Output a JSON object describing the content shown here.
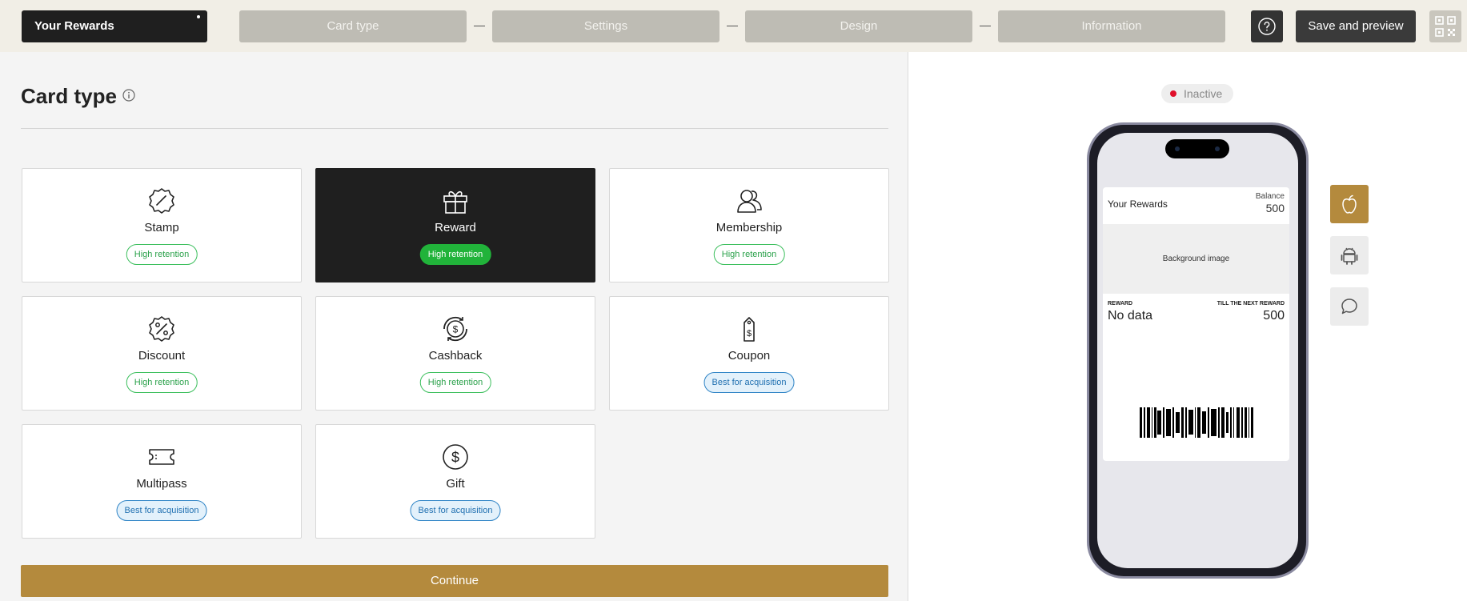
{
  "header": {
    "card_name": "Your Rewards",
    "steps": [
      "Card type",
      "Settings",
      "Design",
      "Information"
    ],
    "help_icon": "question-circle-icon",
    "save_label": "Save and preview",
    "qr_icon": "qr-code-icon"
  },
  "main": {
    "title": "Card type",
    "title_icon": "info-icon",
    "cards": [
      {
        "label": "Stamp",
        "badge": "High retention",
        "badge_style": "green",
        "icon": "stamp-icon",
        "selected": false
      },
      {
        "label": "Reward",
        "badge": "High retention",
        "badge_style": "green",
        "icon": "gift-box-icon",
        "selected": true
      },
      {
        "label": "Membership",
        "badge": "High retention",
        "badge_style": "green",
        "icon": "users-icon",
        "selected": false
      },
      {
        "label": "Discount",
        "badge": "High retention",
        "badge_style": "green",
        "icon": "percent-badge-icon",
        "selected": false
      },
      {
        "label": "Cashback",
        "badge": "High retention",
        "badge_style": "green",
        "icon": "cashback-icon",
        "selected": false
      },
      {
        "label": "Coupon",
        "badge": "Best for acquisition",
        "badge_style": "blue",
        "icon": "price-tag-icon",
        "selected": false
      },
      {
        "label": "Multipass",
        "badge": "Best for acquisition",
        "badge_style": "blue",
        "icon": "ticket-icon",
        "selected": false
      },
      {
        "label": "Gift",
        "badge": "Best for acquisition",
        "badge_style": "blue",
        "icon": "dollar-coin-icon",
        "selected": false
      }
    ],
    "continue_label": "Continue"
  },
  "preview": {
    "status": "Inactive",
    "status_color": "#e0102b",
    "pass": {
      "name": "Your Rewards",
      "balance_label": "Balance",
      "balance_value": "500",
      "background_text": "Background image",
      "field1_label": "REWARD",
      "field1_value": "No data",
      "field2_label": "TILL THE NEXT REWARD",
      "field2_value": "500"
    },
    "platform_buttons": [
      {
        "icon": "apple-icon",
        "active": true
      },
      {
        "icon": "android-icon",
        "active": false
      },
      {
        "icon": "chat-bubble-icon",
        "active": false
      }
    ]
  },
  "colors": {
    "accent": "#b48a3d",
    "dark": "#1f1f1f",
    "green_badge": "#21b33a",
    "blue_badge": "#1f6fb0"
  }
}
